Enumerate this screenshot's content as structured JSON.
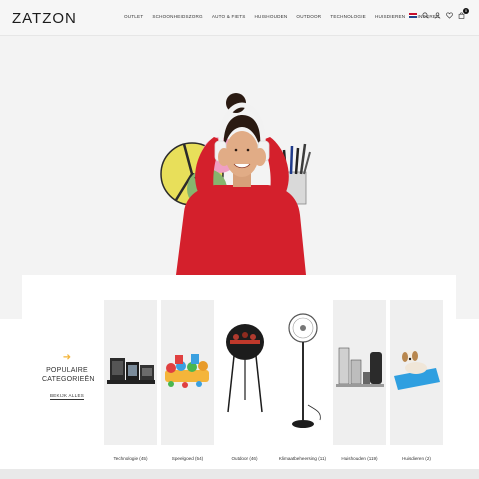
{
  "header": {
    "logo": "ZATZON",
    "nav": [
      "OUTLET",
      "SCHOONHEIDSZORG",
      "AUTO & FIETS",
      "HUISHOUDEN",
      "OUTDOOR",
      "TECHNOLOGIE",
      "HUISDIEREN",
      "KINDEREN"
    ],
    "cart_count": "0"
  },
  "categories": {
    "title_line1": "POPULAIRE",
    "title_line2": "CATEGORIEËN",
    "view_all": "BEKIJK ALLES",
    "items": [
      {
        "label": "Technologie (45)"
      },
      {
        "label": "Speelgoed (54)"
      },
      {
        "label": "Outdoor (46)"
      },
      {
        "label": "Klimaatbeheersing (11)"
      },
      {
        "label": "Huishouden (119)"
      },
      {
        "label": "Huisdieren (2)"
      }
    ]
  },
  "colors": {
    "accent": "#f4b53a",
    "sweater": "#d4202c",
    "background": "#f3f3f3"
  }
}
